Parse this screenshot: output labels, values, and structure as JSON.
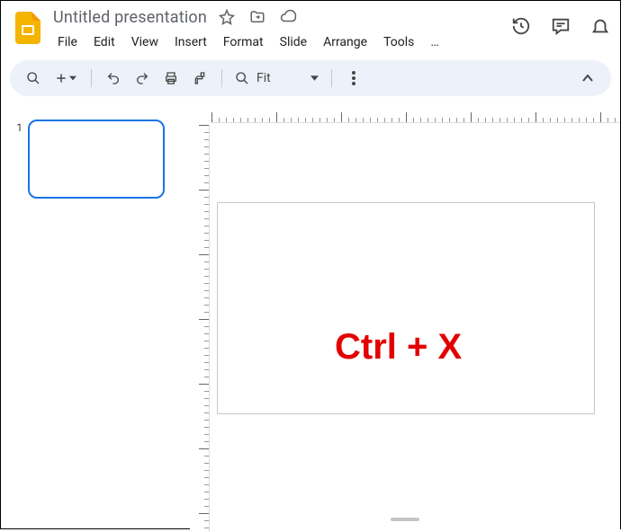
{
  "header": {
    "doc_title": "Untitled presentation",
    "menus": [
      "File",
      "Edit",
      "View",
      "Insert",
      "Format",
      "Slide",
      "Arrange",
      "Tools",
      "…"
    ]
  },
  "toolbar": {
    "zoom_label": "Fit"
  },
  "filmstrip": {
    "slides": [
      {
        "number": "1"
      }
    ]
  },
  "overlay": {
    "text": "Ctrl + X"
  }
}
